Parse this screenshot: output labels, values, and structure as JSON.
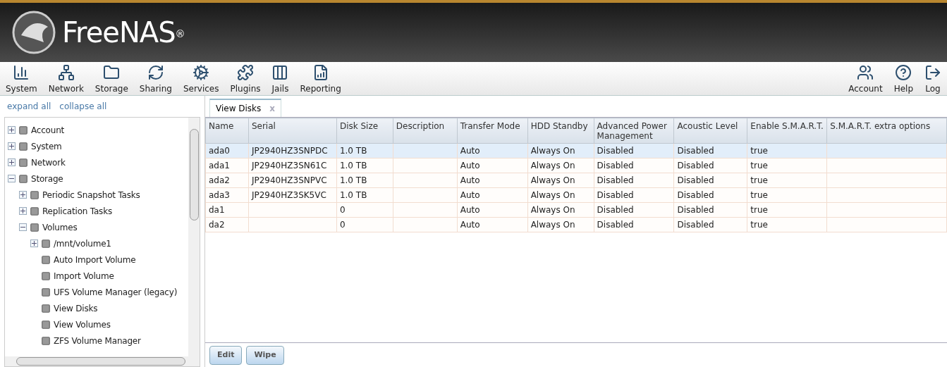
{
  "brand": {
    "name": "FreeNAS",
    "mark": "®"
  },
  "toolbar": {
    "left": [
      {
        "label": "System"
      },
      {
        "label": "Network"
      },
      {
        "label": "Storage"
      },
      {
        "label": "Sharing"
      },
      {
        "label": "Services"
      },
      {
        "label": "Plugins"
      },
      {
        "label": "Jails"
      },
      {
        "label": "Reporting"
      }
    ],
    "right": [
      {
        "label": "Account"
      },
      {
        "label": "Help"
      },
      {
        "label": "Log"
      }
    ]
  },
  "sidebar": {
    "links": [
      "expand all",
      "collapse all"
    ],
    "tree": [
      {
        "label": "Account",
        "expanded": false
      },
      {
        "label": "System",
        "expanded": false
      },
      {
        "label": "Network",
        "expanded": false
      },
      {
        "label": "Storage",
        "expanded": true,
        "children": [
          {
            "label": "Periodic Snapshot Tasks",
            "expanded": false
          },
          {
            "label": "Replication Tasks",
            "expanded": false
          },
          {
            "label": "Volumes",
            "expanded": true,
            "children": [
              {
                "label": "/mnt/volume1",
                "expanded": false
              },
              {
                "label": "Auto Import Volume"
              },
              {
                "label": "Import Volume"
              },
              {
                "label": "UFS Volume Manager (legacy)"
              },
              {
                "label": "View Disks"
              },
              {
                "label": "View Volumes"
              },
              {
                "label": "ZFS Volume Manager"
              }
            ]
          }
        ]
      }
    ]
  },
  "tabs": [
    {
      "label": "View Disks",
      "close": "x",
      "selected": true
    }
  ],
  "table": {
    "columns": [
      "Name",
      "Serial",
      "Disk Size",
      "Description",
      "Transfer Mode",
      "HDD Standby",
      "Advanced Power Management",
      "Acoustic Level",
      "Enable S.M.A.R.T.",
      "S.M.A.R.T. extra options"
    ],
    "rows": [
      {
        "selected": true,
        "cells": [
          "ada0",
          "JP2940HZ3SNPDC",
          "1.0 TB",
          "",
          "Auto",
          "Always On",
          "Disabled",
          "Disabled",
          "true",
          ""
        ]
      },
      {
        "selected": false,
        "cells": [
          "ada1",
          "JP2940HZ3SN61C",
          "1.0 TB",
          "",
          "Auto",
          "Always On",
          "Disabled",
          "Disabled",
          "true",
          ""
        ]
      },
      {
        "selected": false,
        "cells": [
          "ada2",
          "JP2940HZ3SNPVC",
          "1.0 TB",
          "",
          "Auto",
          "Always On",
          "Disabled",
          "Disabled",
          "true",
          ""
        ]
      },
      {
        "selected": false,
        "cells": [
          "ada3",
          "JP2940HZ3SK5VC",
          "1.0 TB",
          "",
          "Auto",
          "Always On",
          "Disabled",
          "Disabled",
          "true",
          ""
        ]
      },
      {
        "selected": false,
        "cells": [
          "da1",
          "",
          "0",
          "",
          "Auto",
          "Always On",
          "Disabled",
          "Disabled",
          "true",
          ""
        ]
      },
      {
        "selected": false,
        "cells": [
          "da2",
          "",
          "0",
          "",
          "Auto",
          "Always On",
          "Disabled",
          "Disabled",
          "true",
          ""
        ]
      }
    ]
  },
  "buttons": [
    "Edit",
    "Wipe"
  ]
}
